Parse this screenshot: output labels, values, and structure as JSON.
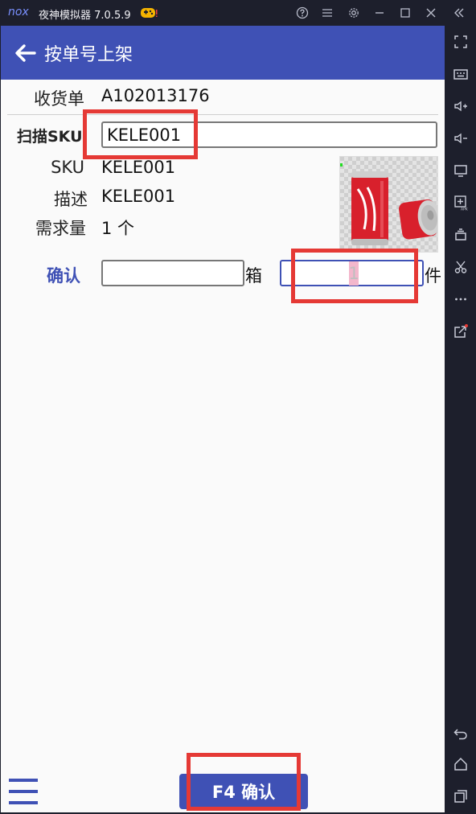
{
  "emulator": {
    "logo_text": "nox",
    "title": "夜神模拟器 7.0.5.9",
    "accent": "#7a90ff",
    "title_icons": [
      "gamepad-icon",
      "help-icon",
      "menu-icon",
      "settings-icon",
      "minimize-icon",
      "maximize-icon",
      "close-icon",
      "collapse-icon"
    ],
    "sidebar_icons": [
      "fullscreen-icon",
      "keyboard-icon",
      "volume-up-icon",
      "volume-down-icon",
      "screen-icon",
      "apk-icon",
      "multi-instance-icon",
      "scissors-icon",
      "more-icon",
      "external-link-icon",
      "back-icon",
      "home-icon",
      "recents-icon"
    ]
  },
  "app": {
    "bar_color": "#3f51b5",
    "title": "按单号上架",
    "receipt_label": "收货单",
    "receipt_value": "A102013176",
    "scan_label": "扫描SKU",
    "scan_value": "KELE001",
    "sku_label": "SKU",
    "sku_value": "KELE001",
    "desc_label": "描述",
    "desc_value": "KELE001",
    "demand_label": "需求量",
    "demand_value": "1 个",
    "confirm_label": "确认",
    "box_unit": "箱",
    "box_value": "",
    "piece_value": "1",
    "piece_unit": "件",
    "product_image": "coca-cola-can-image",
    "bottom_button": "F4 确认",
    "highlight_color": "#e53935"
  }
}
